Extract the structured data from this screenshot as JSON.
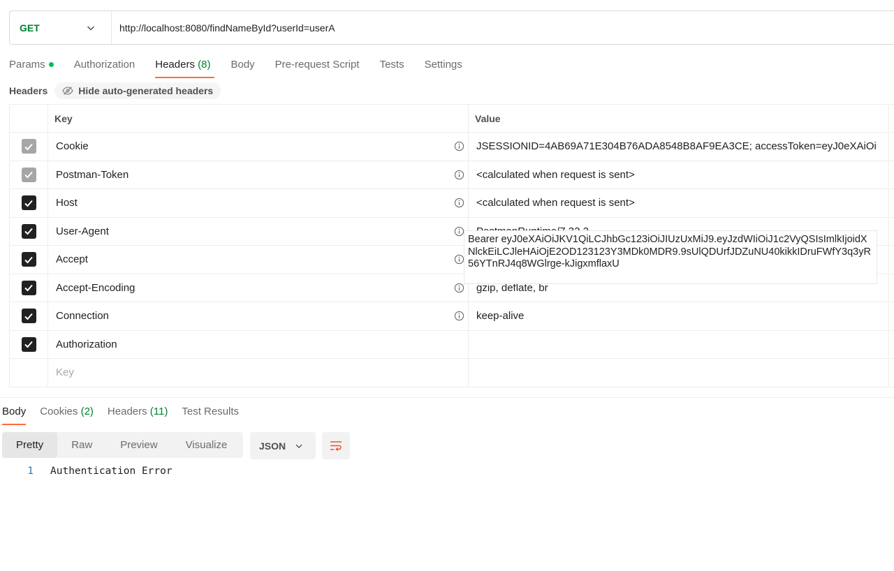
{
  "request": {
    "method": "GET",
    "url": "http://localhost:8080/findNameById?userId=userA"
  },
  "request_tabs": [
    {
      "label": "Params",
      "count": "",
      "active": false,
      "dot": true
    },
    {
      "label": "Authorization",
      "count": "",
      "active": false
    },
    {
      "label": "Headers",
      "count": "(8)",
      "active": true
    },
    {
      "label": "Body",
      "count": "",
      "active": false
    },
    {
      "label": "Pre-request Script",
      "count": "",
      "active": false
    },
    {
      "label": "Tests",
      "count": "",
      "active": false
    },
    {
      "label": "Settings",
      "count": "",
      "active": false
    }
  ],
  "headers_section": {
    "title": "Headers",
    "hide_button": "Hide auto-generated headers",
    "col_key": "Key",
    "col_value": "Value",
    "key_placeholder": "Key",
    "rows": [
      {
        "key": "Cookie",
        "value": "JSESSIONID=4AB69A71E304B76ADA8548B8AF9EA3CE; accessToken=eyJ0eXAiOi",
        "checked": true,
        "disabled": true,
        "info": true
      },
      {
        "key": "Postman-Token",
        "value": "<calculated when request is sent>",
        "checked": true,
        "disabled": true,
        "info": true
      },
      {
        "key": "Host",
        "value": "<calculated when request is sent>",
        "checked": true,
        "disabled": false,
        "info": true
      },
      {
        "key": "User-Agent",
        "value": "PostmanRuntime/7.32.2",
        "checked": true,
        "disabled": false,
        "info": true
      },
      {
        "key": "Accept",
        "value": "*/*",
        "checked": true,
        "disabled": false,
        "info": true
      },
      {
        "key": "Accept-Encoding",
        "value": "gzip, deflate, br",
        "checked": true,
        "disabled": false,
        "info": true
      },
      {
        "key": "Connection",
        "value": "keep-alive",
        "checked": true,
        "disabled": false,
        "info": true
      },
      {
        "key": "Authorization",
        "value": "",
        "checked": true,
        "disabled": false,
        "info": false
      }
    ],
    "authorization_value": "Bearer eyJ0eXAiOiJKV1QiLCJhbGc123iOiJIUzUxMiJ9.eyJzdWIiOiJ1c2VyQSIsImlkIjoidXNlckEiLCJleHAiOjE2OD123123Y3MDk0MDR9.9sUlQDUrfJDZuNU40kikkIDruFWfY3q3yR56YTnRJ4q8WGlrge-kJigxmflaxU"
  },
  "response_tabs": [
    {
      "label": "Body",
      "count": "",
      "active": true
    },
    {
      "label": "Cookies",
      "count": "(2)",
      "active": false
    },
    {
      "label": "Headers",
      "count": "(11)",
      "active": false
    },
    {
      "label": "Test Results",
      "count": "",
      "active": false
    }
  ],
  "format_options": [
    "Pretty",
    "Raw",
    "Preview",
    "Visualize"
  ],
  "format_active": "Pretty",
  "language": "JSON",
  "response_body": {
    "line_number": "1",
    "text": "Authentication Error"
  },
  "colors": {
    "method_get": "#007f31",
    "accent": "#ff6c37",
    "count_green": "#007f31"
  }
}
